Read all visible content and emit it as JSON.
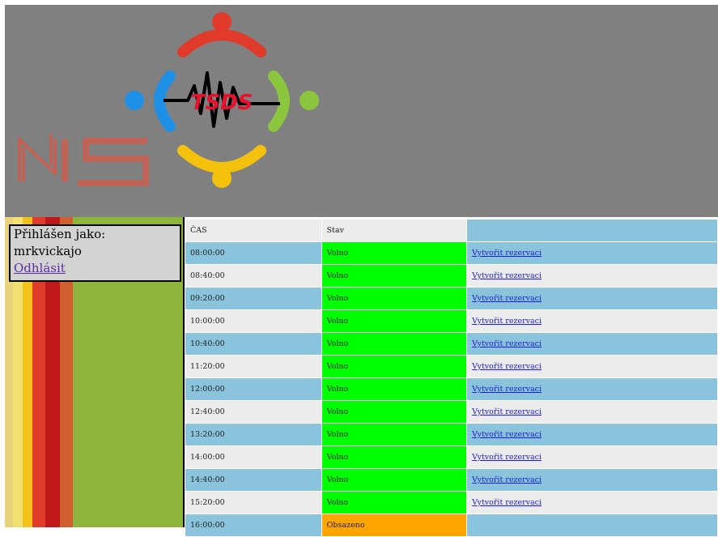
{
  "header": {
    "logo_left_text": "NIS",
    "logo_center_text": "TSDS",
    "colors": {
      "background": "#808080",
      "red": "#e03a2b",
      "blue": "#1e90e6",
      "green": "#8cc63f",
      "yellow": "#f4c20d",
      "nis": "#d45a4a"
    }
  },
  "login": {
    "label": "Přihlášen jako:",
    "username": "mrkvickajo",
    "logout": "Odhlásit"
  },
  "table": {
    "headers": {
      "time": "ČAS",
      "status": "Stav",
      "action": ""
    },
    "rows": [
      {
        "time": "08:00:00",
        "status": "Volno",
        "action": "Vytvořit rezervaci",
        "state": "free"
      },
      {
        "time": "08:40:00",
        "status": "Volno",
        "action": "Vytvořit rezervaci",
        "state": "free"
      },
      {
        "time": "09:20:00",
        "status": "Volno",
        "action": "Vytvořit rezervaci",
        "state": "free"
      },
      {
        "time": "10:00:00",
        "status": "Volno",
        "action": "Vytvořit rezervaci",
        "state": "free"
      },
      {
        "time": "10:40:00",
        "status": "Volno",
        "action": "Vytvořit rezervaci",
        "state": "free"
      },
      {
        "time": "11:20:00",
        "status": "Volno",
        "action": "Vytvořit rezervaci",
        "state": "free"
      },
      {
        "time": "12:00:00",
        "status": "Volno",
        "action": "Vytvořit rezervaci",
        "state": "free"
      },
      {
        "time": "12:40:00",
        "status": "Volno",
        "action": "Vytvořit rezervaci",
        "state": "free"
      },
      {
        "time": "13:20:00",
        "status": "Volno",
        "action": "Vytvořit rezervaci",
        "state": "free"
      },
      {
        "time": "14:00:00",
        "status": "Volno",
        "action": "Vytvořit rezervaci",
        "state": "free"
      },
      {
        "time": "14:40:00",
        "status": "Volno",
        "action": "Vytvořit rezervaci",
        "state": "free"
      },
      {
        "time": "15:20:00",
        "status": "Volno",
        "action": "Vytvořit rezervaci",
        "state": "free"
      },
      {
        "time": "16:00:00",
        "status": "Obsazeno",
        "action": "",
        "state": "busy"
      }
    ],
    "colors": {
      "free": "#00ff00",
      "busy": "#ffa500",
      "row_blue": "#89c4dc",
      "row_gray": "#ececec",
      "link": "#1d1dcc"
    }
  },
  "sidebar": {
    "colors": {
      "base": "#8db53c",
      "stripes": [
        "#e8d27a",
        "#f2e070",
        "#f2c21a",
        "#e03a2b",
        "#c01818",
        "#d06030"
      ]
    }
  }
}
